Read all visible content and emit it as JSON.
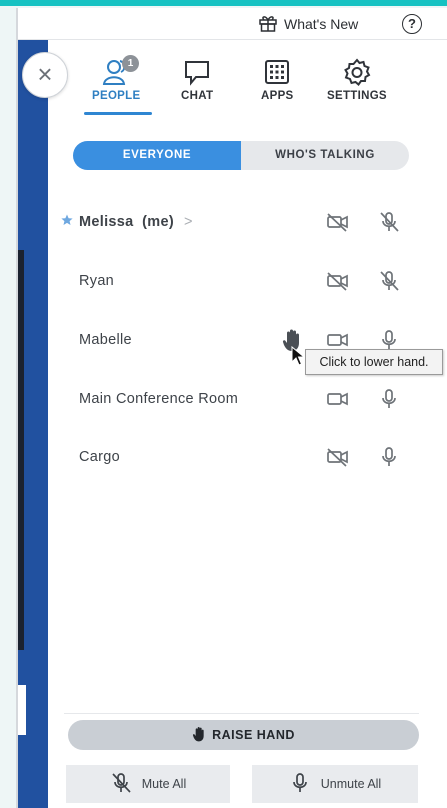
{
  "header": {
    "whats_new": "What's New",
    "help": "?"
  },
  "close": "×",
  "tabs": [
    {
      "label": "PEOPLE",
      "badge": "1",
      "icon": "people-icon",
      "active": true
    },
    {
      "label": "CHAT",
      "icon": "chat-icon"
    },
    {
      "label": "APPS",
      "icon": "apps-icon"
    },
    {
      "label": "SETTINGS",
      "icon": "settings-icon"
    }
  ],
  "filter": {
    "everyone": "EVERYONE",
    "talking": "WHO'S TALKING"
  },
  "people": [
    {
      "name": "Melissa",
      "suffix": "(me)",
      "chevron": ">",
      "starred": true,
      "video": "off",
      "mic": "off"
    },
    {
      "name": "Ryan",
      "video": "off",
      "mic": "off"
    },
    {
      "name": "Mabelle",
      "hand_raised": true,
      "video": "on",
      "mic": "on"
    },
    {
      "name": "Main Conference Room",
      "video": "on",
      "mic": "on"
    },
    {
      "name": "Cargo",
      "video": "off",
      "mic": "on"
    }
  ],
  "tooltip": "Click to lower hand.",
  "footer": {
    "raise_hand": "RAISE HAND",
    "mute_all": "Mute All",
    "unmute_all": "Unmute All"
  },
  "colors": {
    "accent": "#3a8fe0",
    "icon_gray": "#6e7378",
    "app_blue": "#2151a0"
  }
}
